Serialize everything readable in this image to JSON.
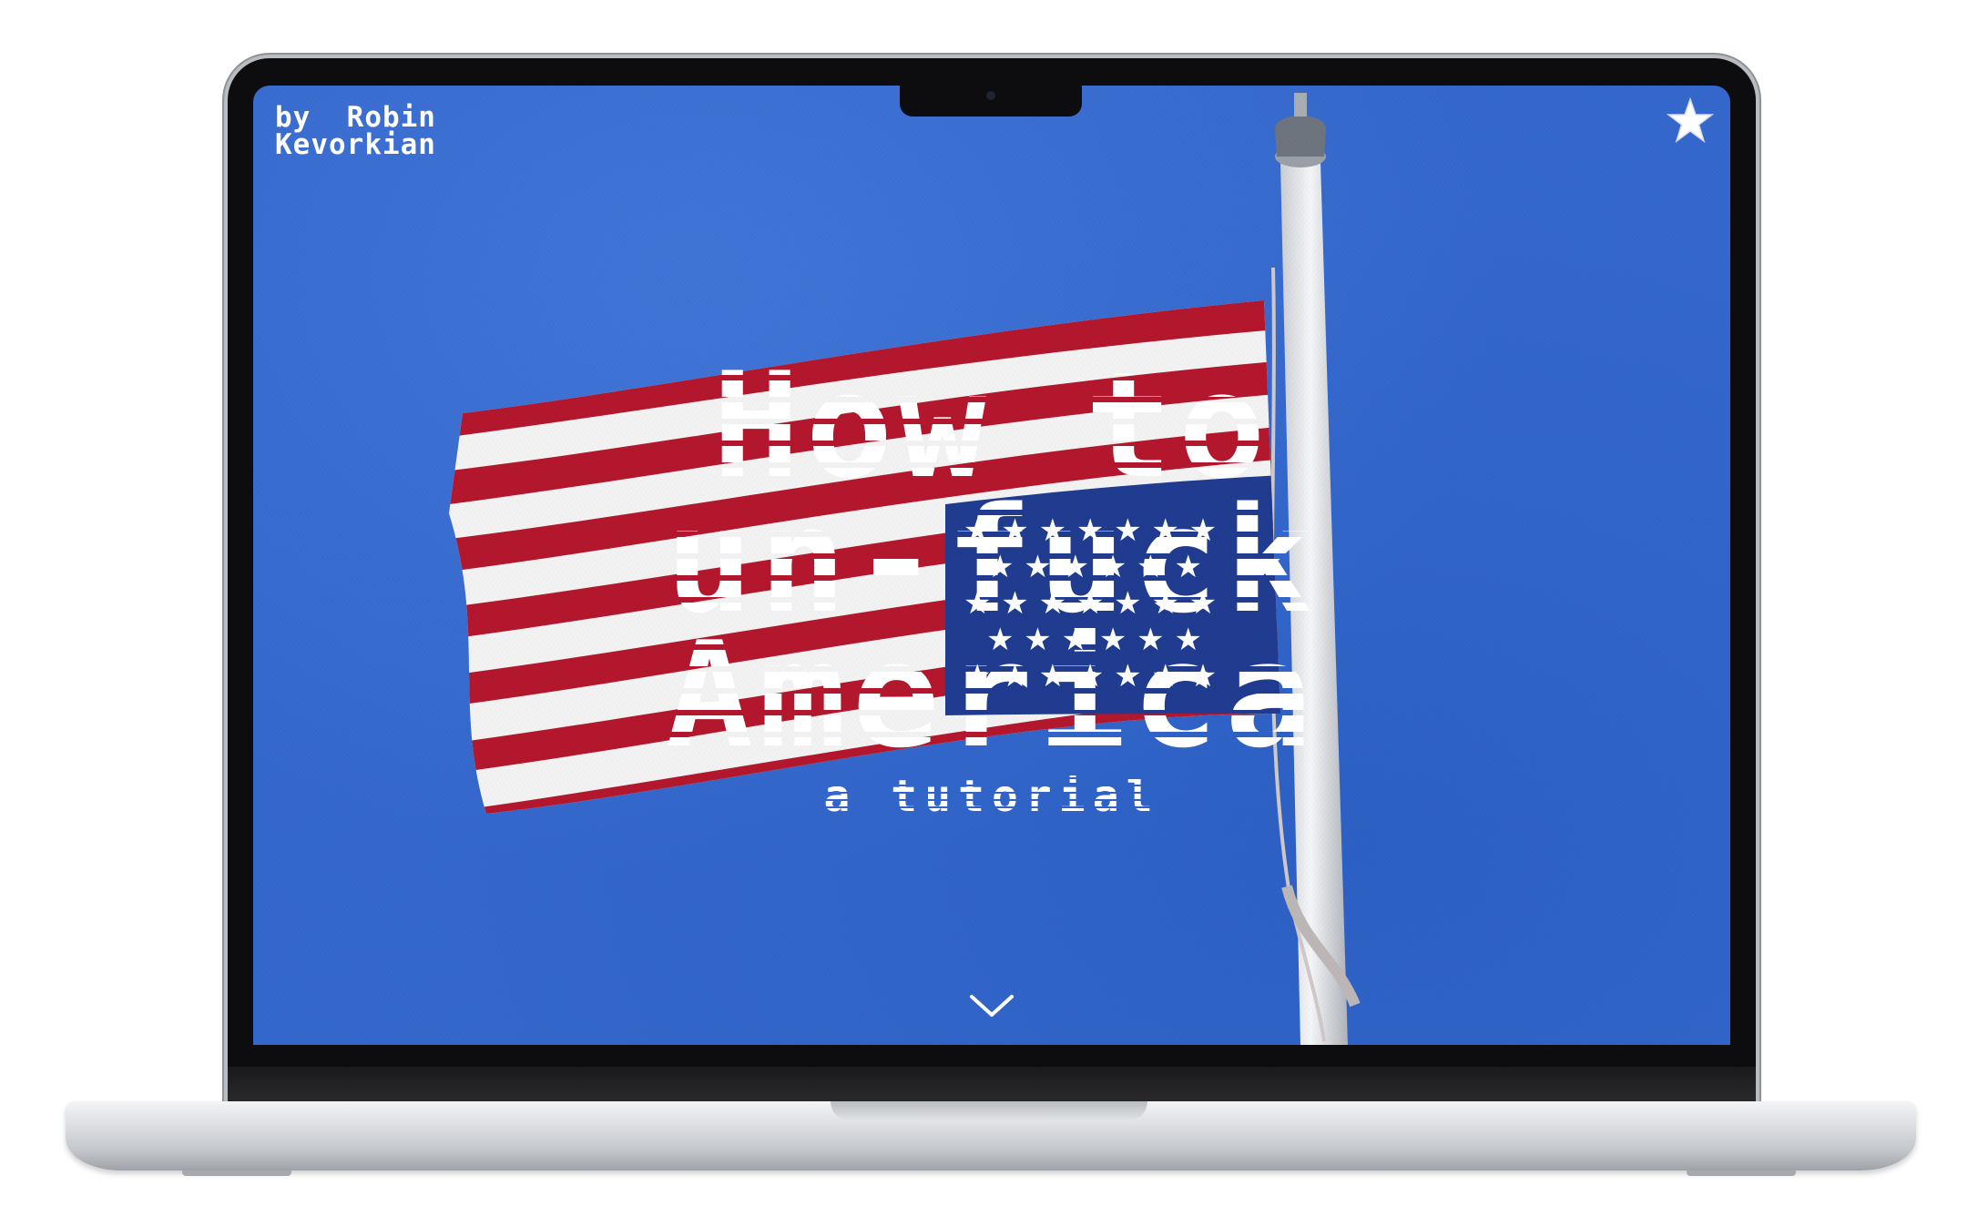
{
  "byline": {
    "line1": "by  Robin",
    "line2": "Kevorkian"
  },
  "hero": {
    "line1": "How to",
    "line2": "un-fuck",
    "line3": "America",
    "subtitle": "a tutorial"
  },
  "icons": {
    "top_right": "star-icon",
    "bottom": "chevron-down-icon"
  },
  "colors": {
    "sky_blue": "#3467cc",
    "flag_red": "#b3162c",
    "flag_white": "#f2f2f2",
    "flag_blue": "#1f3b8f",
    "text": "#ffffff"
  }
}
